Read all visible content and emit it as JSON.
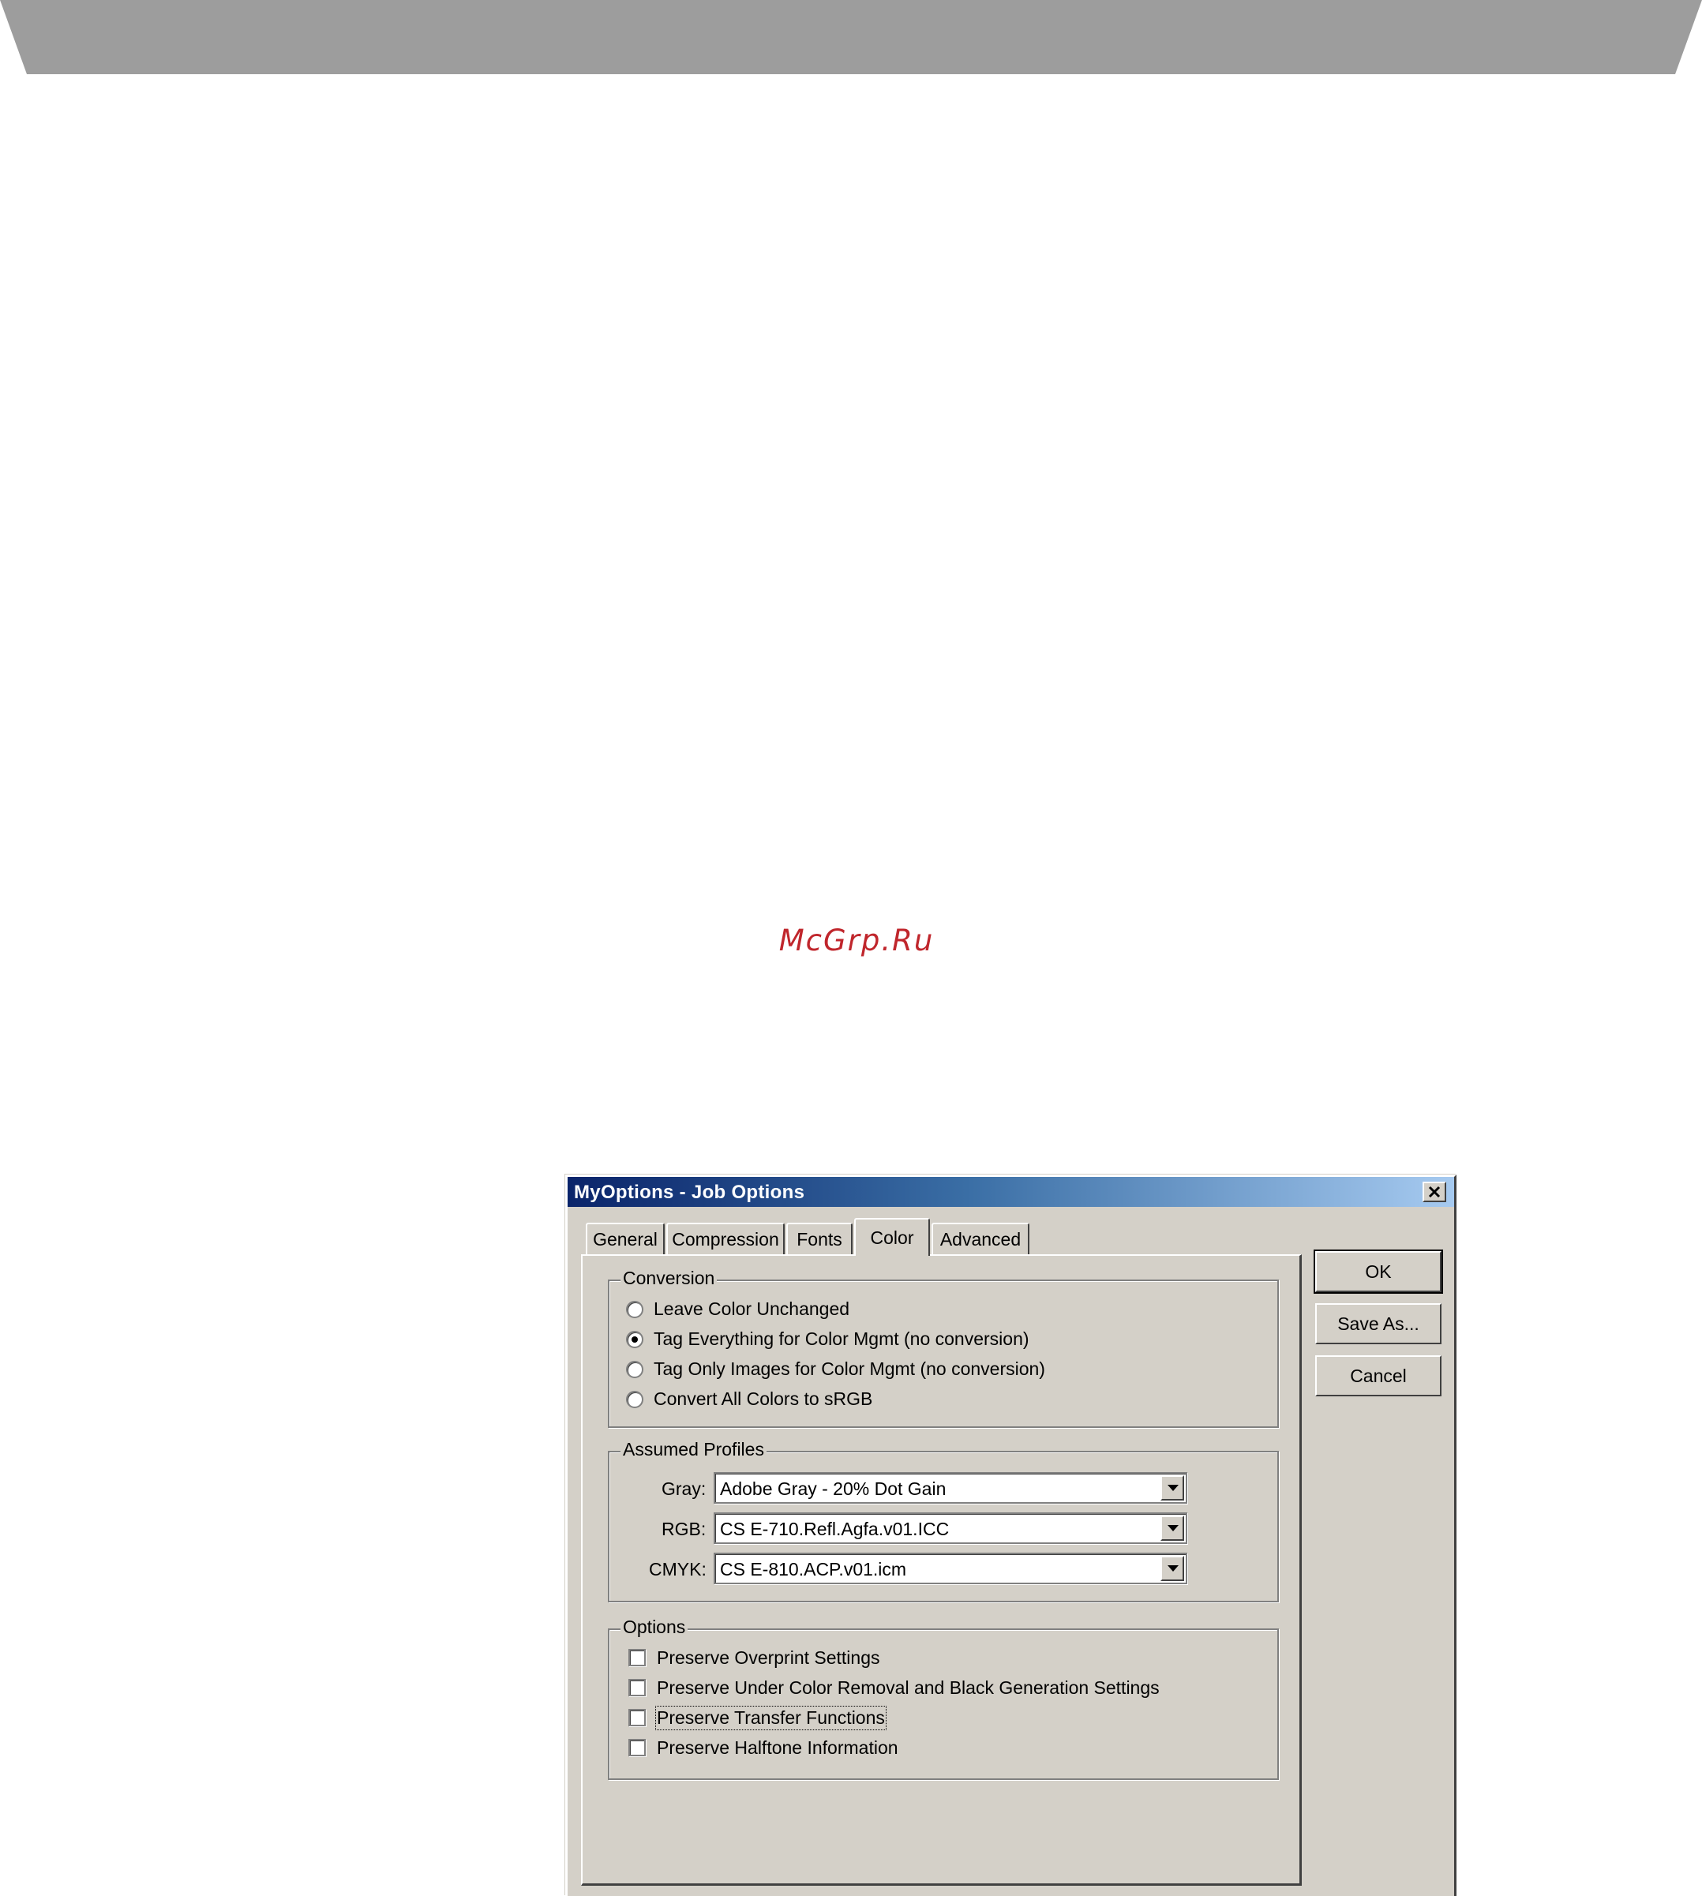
{
  "watermark": "McGrp.Ru",
  "dialog": {
    "title": "MyOptions - Job Options",
    "close_glyph": "✕"
  },
  "tabs": [
    {
      "label": "General"
    },
    {
      "label": "Compression"
    },
    {
      "label": "Fonts"
    },
    {
      "label": "Color",
      "active": true
    },
    {
      "label": "Advanced"
    }
  ],
  "conversion": {
    "title": "Conversion",
    "options": [
      {
        "label": "Leave Color Unchanged",
        "checked": false
      },
      {
        "label": "Tag Everything for Color Mgmt (no conversion)",
        "checked": true
      },
      {
        "label": "Tag Only Images for Color Mgmt (no conversion)",
        "checked": false
      },
      {
        "label": "Convert All Colors to sRGB",
        "checked": false
      }
    ]
  },
  "assumed_profiles": {
    "title": "Assumed Profiles",
    "gray_label": "Gray:",
    "gray_value": "Adobe Gray - 20% Dot Gain",
    "rgb_label": "RGB:",
    "rgb_value": "CS E-710.Refl.Agfa.v01.ICC",
    "cmyk_label": "CMYK:",
    "cmyk_value": "CS E-810.ACP.v01.icm"
  },
  "options": {
    "title": "Options",
    "items": [
      {
        "label": "Preserve Overprint Settings",
        "checked": false
      },
      {
        "label": "Preserve Under Color Removal and Black Generation Settings",
        "checked": false
      },
      {
        "label": "Preserve Transfer Functions",
        "checked": false
      },
      {
        "label": "Preserve Halftone Information",
        "checked": false
      }
    ]
  },
  "buttons": {
    "ok": "OK",
    "save_as": "Save As...",
    "cancel": "Cancel"
  },
  "colors": {
    "banner": "#9d9d9d",
    "watermark": "#c0262c",
    "dialog_face": "#d4d0c8",
    "titlebar_start": "#0a246a",
    "titlebar_end": "#a6caf0"
  }
}
